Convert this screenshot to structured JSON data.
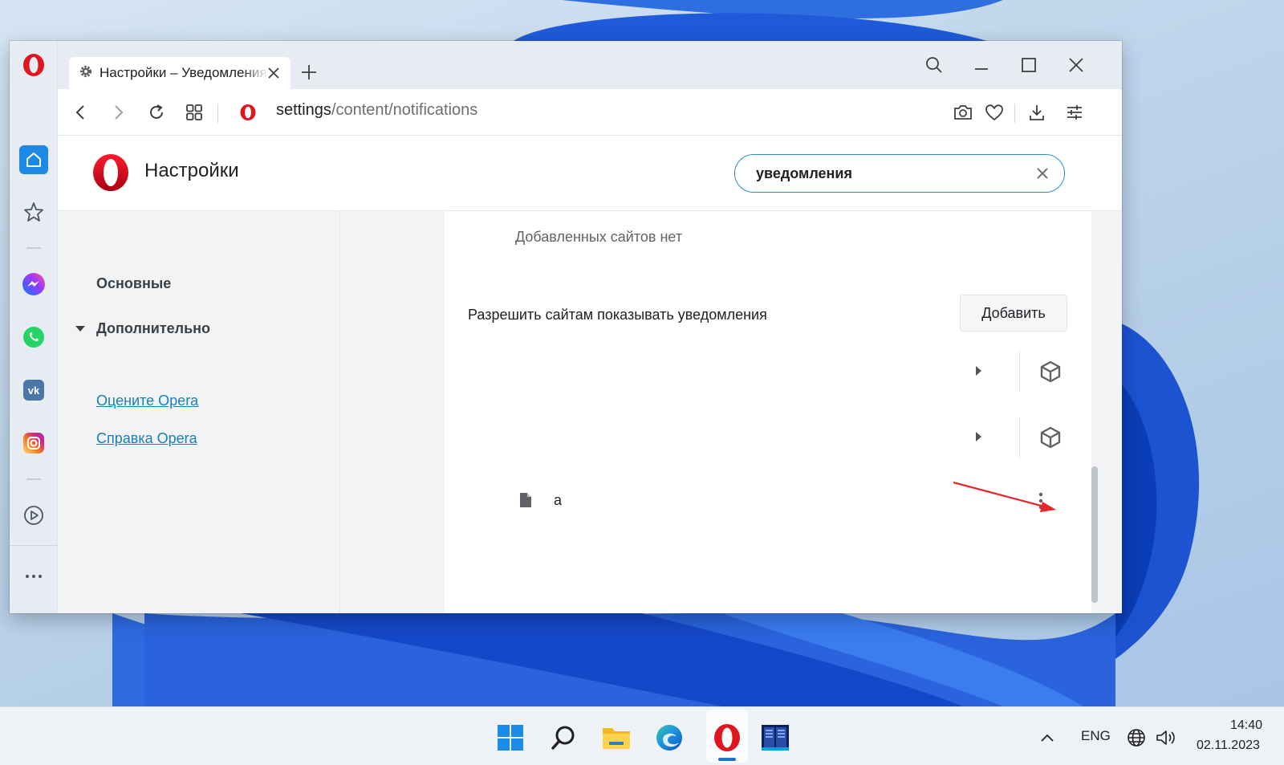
{
  "browser": {
    "tab_title": "Настройки – Уведомления",
    "url_host": "settings",
    "url_path": "/content/notifications"
  },
  "settings": {
    "title": "Настройки",
    "search_value": "уведомления",
    "nav": {
      "main": "Основные",
      "advanced": "Дополнительно",
      "rate_link": "Оцените Opera",
      "help_link": "Справка Opera"
    },
    "content": {
      "no_sites_text": "Добавленных сайтов нет",
      "allow_label": "Разрешить сайтам показывать уведомления",
      "add_button": "Добавить",
      "site_name": "a"
    }
  },
  "sidebar_icons": [
    "opera-logo-icon",
    "home-icon",
    "bookmarks-icon",
    "messenger-icon",
    "whatsapp-icon",
    "vk-icon",
    "instagram-icon",
    "player-icon",
    "more-icon"
  ],
  "taskbar": {
    "apps": [
      "windows-start-icon",
      "search-icon",
      "file-explorer-icon",
      "edge-icon",
      "opera-icon",
      "terminal-app-icon"
    ],
    "language": "ENG",
    "time": "14:40",
    "date": "02.11.2023"
  },
  "colors": {
    "accent": "#1a7fb5",
    "search_border": "#2a8fbf",
    "opera_red": "#e0161e",
    "annotation_arrow": "#e8262a"
  }
}
